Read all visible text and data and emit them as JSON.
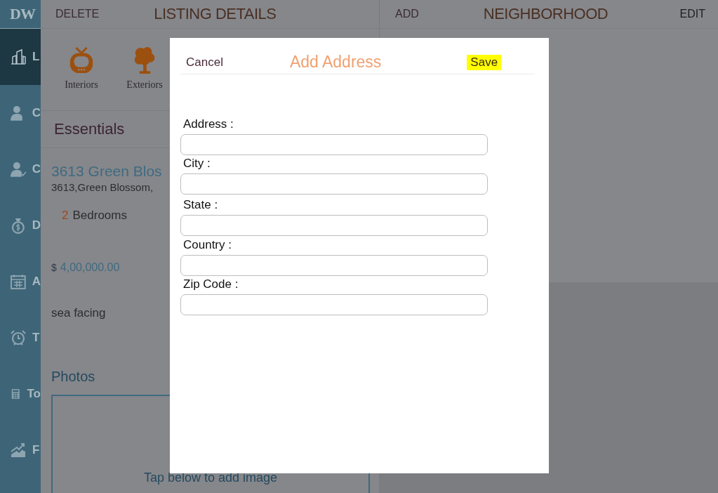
{
  "sidebar": {
    "logo": "DW",
    "items": [
      {
        "label": "L",
        "selected": true
      },
      {
        "label": "C",
        "selected": false
      },
      {
        "label": "C",
        "selected": false
      },
      {
        "label": "D",
        "selected": false
      },
      {
        "label": "A",
        "selected": false
      },
      {
        "label": "T",
        "selected": false
      },
      {
        "label": "To",
        "selected": false
      },
      {
        "label": "F",
        "selected": false
      }
    ]
  },
  "listing": {
    "delete_button": "DELETE",
    "title": "LISTING DETAILS",
    "categories": [
      {
        "label": "Interiors"
      },
      {
        "label": "Exteriors"
      }
    ],
    "section_title": "Essentials",
    "name": "3613 Green Blos",
    "address": "3613,Green Blossom,",
    "bedrooms_count": "2",
    "bedrooms_label": "Bedrooms",
    "currency": "$",
    "price": "4,00,000.00",
    "description": "sea facing",
    "photos_title": "Photos",
    "photos_hint": "Tap below to add image"
  },
  "neighborhood": {
    "add_button": "ADD",
    "title": "NEIGHBORHOOD",
    "edit_button": "EDIT"
  },
  "dialog": {
    "cancel_button": "Cancel",
    "title": "Add Address",
    "save_button": "Save",
    "fields": [
      {
        "label": "Address :"
      },
      {
        "label": "City :"
      },
      {
        "label": "State :"
      },
      {
        "label": "Country :"
      },
      {
        "label": "Zip Code :"
      }
    ]
  }
}
